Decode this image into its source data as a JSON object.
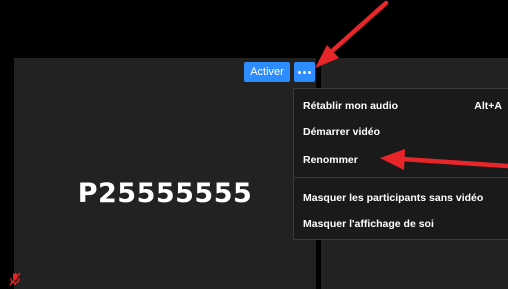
{
  "participant": {
    "name": "P25555555"
  },
  "toolbar": {
    "activer_label": "Activer",
    "more_icon": "more-dots-icon"
  },
  "menu": {
    "items": [
      {
        "label": "Rétablir mon audio",
        "shortcut": "Alt+A"
      },
      {
        "label": "Démarrer vidéo"
      },
      {
        "label": "Renommer"
      },
      {
        "label": "Masquer les participants sans vidéo"
      },
      {
        "label": "Masquer l'affichage de soi"
      }
    ]
  },
  "colors": {
    "accent": "#2d8cff",
    "annotation_arrow": "#e8262a",
    "mic_muted": "#e02828"
  }
}
